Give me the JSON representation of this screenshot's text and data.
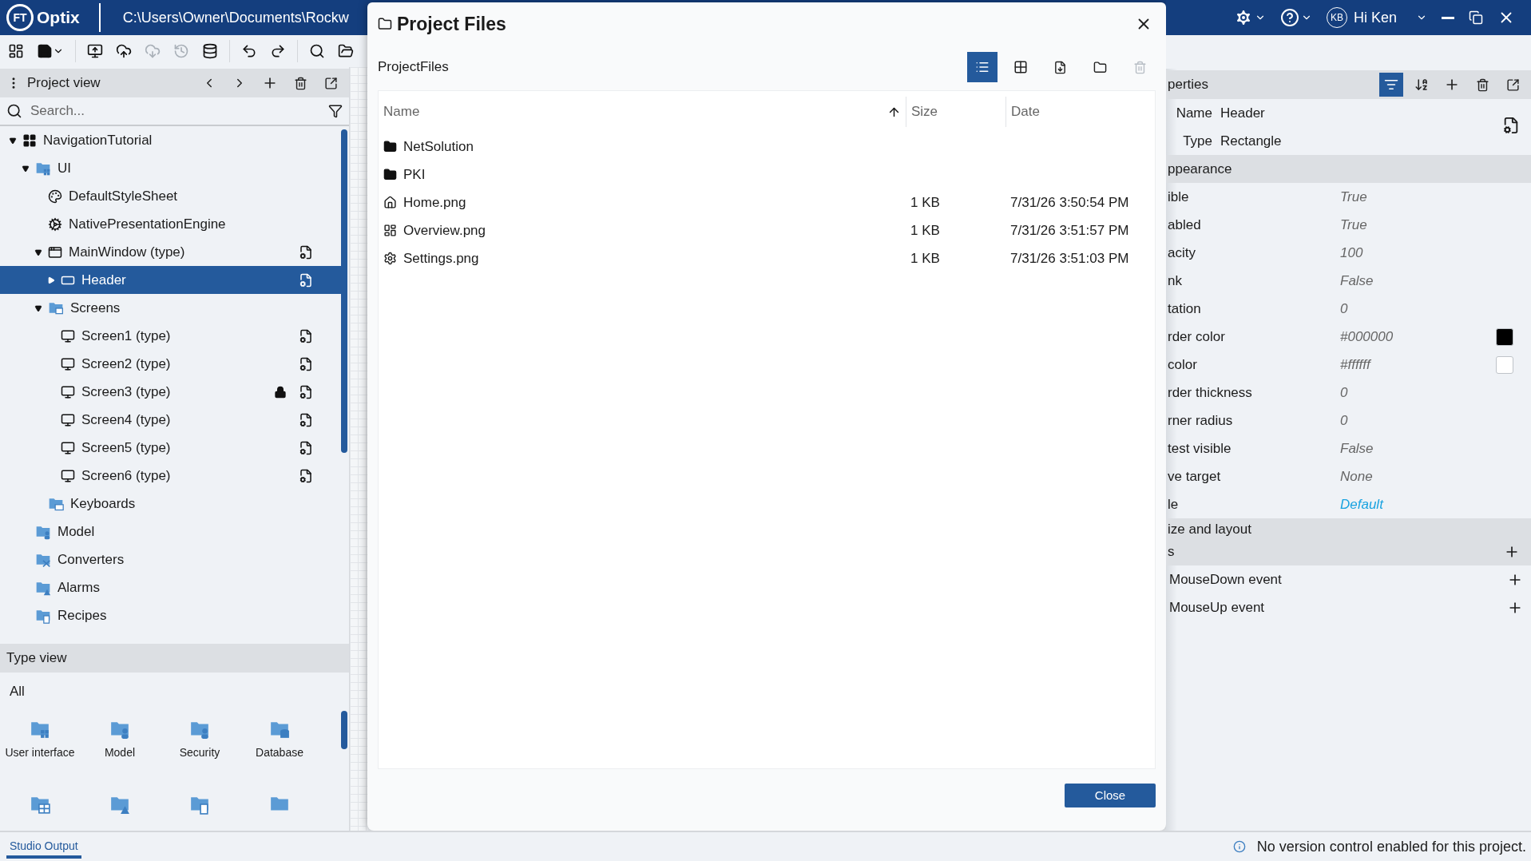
{
  "app": {
    "logo_badge": "FT",
    "logo": "Optix",
    "path": "C:\\Users\\Owner\\Documents\\Rockw",
    "user_initials": "KB",
    "greeting": "Hi Ken"
  },
  "toolbar": [
    {
      "disabled": false
    },
    {
      "disabled": false
    },
    {
      "disabled": false
    },
    {
      "disabled": false
    },
    {
      "disabled": true
    },
    {
      "disabled": true
    },
    {
      "disabled": false
    },
    {
      "disabled": false
    },
    {
      "disabled": false
    },
    {
      "disabled": false
    },
    {
      "disabled": false
    }
  ],
  "project_view": {
    "title": "Project view",
    "search": {
      "placeholder": "Search..."
    },
    "tree": [
      {
        "label": "NavigationTutorial",
        "kind": "project",
        "expanded": true,
        "selected": false,
        "locked": false,
        "type_editor": false,
        "children": [
          {
            "label": "UI",
            "kind": "ui-folder",
            "expanded": true,
            "selected": false,
            "locked": false,
            "type_editor": false,
            "children": [
              {
                "label": "DefaultStyleSheet",
                "kind": "stylesheet",
                "selected": false,
                "locked": false,
                "type_editor": false
              },
              {
                "label": "NativePresentationEngine",
                "kind": "engine",
                "selected": false,
                "locked": false,
                "type_editor": false
              },
              {
                "label": "MainWindow (type)",
                "kind": "window",
                "expanded": true,
                "selected": false,
                "locked": false,
                "type_editor": true,
                "children": [
                  {
                    "label": "Header",
                    "kind": "rectangle",
                    "expanded": false,
                    "selected": true,
                    "locked": false,
                    "type_editor": true
                  }
                ]
              },
              {
                "label": "Screens",
                "kind": "screens-folder",
                "expanded": true,
                "selected": false,
                "locked": false,
                "type_editor": false,
                "children": [
                  {
                    "label": "Screen1 (type)",
                    "kind": "screen",
                    "selected": false,
                    "locked": false,
                    "type_editor": true
                  },
                  {
                    "label": "Screen2 (type)",
                    "kind": "screen",
                    "selected": false,
                    "locked": false,
                    "type_editor": true
                  },
                  {
                    "label": "Screen3 (type)",
                    "kind": "screen",
                    "selected": false,
                    "locked": true,
                    "type_editor": true
                  },
                  {
                    "label": "Screen4 (type)",
                    "kind": "screen",
                    "selected": false,
                    "locked": false,
                    "type_editor": true
                  },
                  {
                    "label": "Screen5 (type)",
                    "kind": "screen",
                    "selected": false,
                    "locked": false,
                    "type_editor": true
                  },
                  {
                    "label": "Screen6 (type)",
                    "kind": "screen",
                    "selected": false,
                    "locked": false,
                    "type_editor": true
                  }
                ]
              },
              {
                "label": "Keyboards",
                "kind": "keyboard-folder",
                "selected": false,
                "locked": false,
                "type_editor": false
              }
            ]
          },
          {
            "label": "Model",
            "kind": "model-folder",
            "selected": false,
            "locked": false,
            "type_editor": false
          },
          {
            "label": "Converters",
            "kind": "converter-folder",
            "selected": false,
            "locked": false,
            "type_editor": false
          },
          {
            "label": "Alarms",
            "kind": "alarm-folder",
            "selected": false,
            "locked": false,
            "type_editor": false
          },
          {
            "label": "Recipes",
            "kind": "recipe-folder",
            "selected": false,
            "locked": false,
            "type_editor": false
          }
        ]
      }
    ]
  },
  "type_view": {
    "title": "Type view",
    "filter": "All",
    "items": [
      {
        "kind": "ui",
        "label": "User interface"
      },
      {
        "kind": "model",
        "label": "Model"
      },
      {
        "kind": "security",
        "label": "Security"
      },
      {
        "kind": "database",
        "label": "Database"
      },
      {
        "kind": "table"
      },
      {
        "kind": "alarm"
      },
      {
        "kind": "recipe"
      },
      {
        "kind": "folder"
      }
    ]
  },
  "dialog": {
    "title": "Project Files",
    "path": "ProjectFiles",
    "view_modes": [
      {
        "selected": true
      },
      {
        "selected": false
      }
    ],
    "actions": [
      {
        "disabled": false
      },
      {
        "disabled": false
      },
      {
        "disabled": true
      }
    ],
    "columns": [
      {
        "label": "Name",
        "sorted": true
      },
      {
        "label": "Size",
        "sorted": false
      },
      {
        "label": "Date",
        "sorted": false
      }
    ],
    "rows": [
      {
        "kind": "folder",
        "name": "NetSolution"
      },
      {
        "kind": "folder",
        "name": "PKI"
      },
      {
        "kind": "home",
        "name": "Home.png",
        "size": "1 KB",
        "date": "7/31/26 3:50:54 PM"
      },
      {
        "kind": "overview",
        "name": "Overview.png",
        "size": "1 KB",
        "date": "7/31/26 3:51:57 PM"
      },
      {
        "kind": "settings",
        "name": "Settings.png",
        "size": "1 KB",
        "date": "7/31/26 3:51:03 PM"
      }
    ],
    "button": "Close"
  },
  "properties": {
    "title": "perties",
    "tools": [
      {
        "selected": true
      },
      {
        "selected": false
      }
    ],
    "name_label": "Name",
    "name": "Header",
    "type_label": "Type",
    "type": "Rectangle",
    "sections": [
      {
        "kind": "group",
        "title": "ppearance",
        "rows": [
          {
            "kind": "plain",
            "label": "ible",
            "value": "True"
          },
          {
            "kind": "plain",
            "label": "abled",
            "value": "True"
          },
          {
            "kind": "plain",
            "label": "acity",
            "value": "100"
          },
          {
            "kind": "plain",
            "label": "nk",
            "value": "False"
          },
          {
            "kind": "plain",
            "label": "tation",
            "value": "0"
          },
          {
            "kind": "color",
            "label": "rder color",
            "value": "#000000",
            "color": "#000000"
          },
          {
            "kind": "color",
            "label": "color",
            "value": "#ffffff",
            "color": "#ffffff"
          },
          {
            "kind": "plain",
            "label": "rder thickness",
            "value": "0"
          },
          {
            "kind": "plain",
            "label": "rner radius",
            "value": "0"
          },
          {
            "kind": "plain",
            "label": "test visible",
            "value": "False"
          },
          {
            "kind": "plain",
            "label": "ve target",
            "value": "None"
          },
          {
            "kind": "link",
            "label": "le",
            "value": "Default"
          }
        ]
      },
      {
        "kind": "group",
        "title": "ize and layout"
      },
      {
        "kind": "events",
        "title": "s",
        "rows": [
          {
            "label": "MouseDown event"
          },
          {
            "label": "MouseUp event"
          }
        ]
      }
    ]
  },
  "status_bar": {
    "tab": "Studio Output",
    "message": "No version control enabled for this project."
  }
}
